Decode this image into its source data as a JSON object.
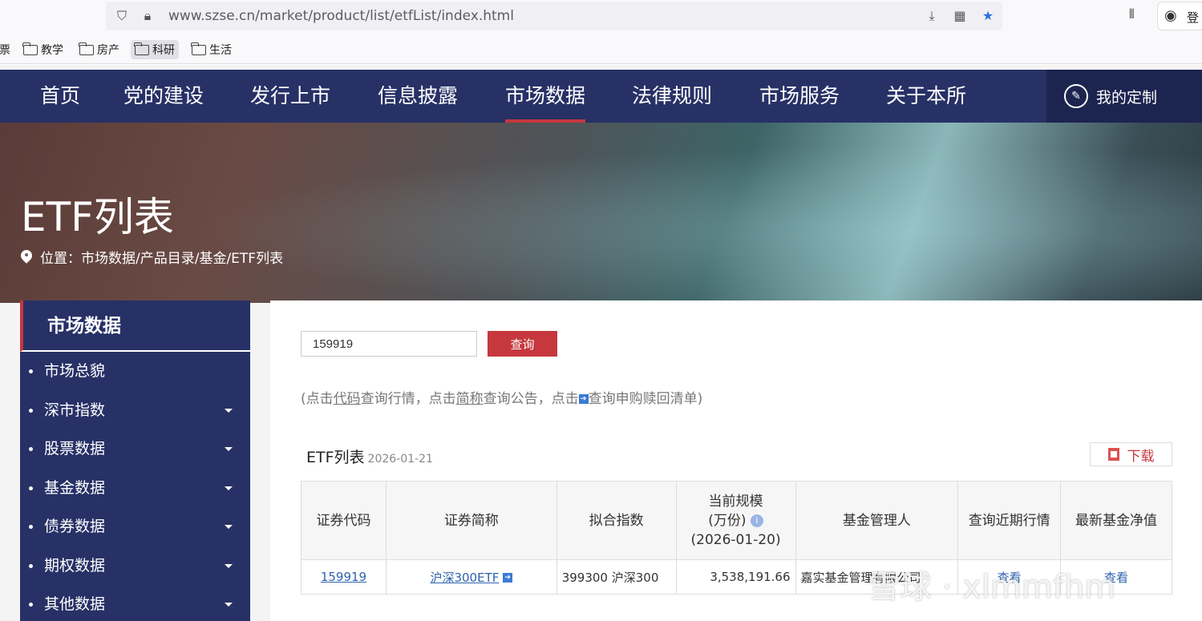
{
  "browser": {
    "url": "www.szse.cn/market/product/list/etfList/index.html",
    "profile_label": "登",
    "bookmarks": [
      "票",
      "教学",
      "房产",
      "科研",
      "生活"
    ]
  },
  "nav": {
    "items": [
      "首页",
      "党的建设",
      "发行上市",
      "信息披露",
      "市场数据",
      "法律规则",
      "市场服务",
      "关于本所"
    ],
    "active": "市场数据",
    "custom_label": "我的定制"
  },
  "banner": {
    "title": "ETF列表",
    "breadcrumb": "位置：市场数据/产品目录/基金/ETF列表"
  },
  "sidebar": {
    "title": "市场数据",
    "items": [
      {
        "label": "市场总貌",
        "expandable": false
      },
      {
        "label": "深市指数",
        "expandable": true
      },
      {
        "label": "股票数据",
        "expandable": true
      },
      {
        "label": "基金数据",
        "expandable": true
      },
      {
        "label": "债券数据",
        "expandable": true
      },
      {
        "label": "期权数据",
        "expandable": true
      },
      {
        "label": "其他数据",
        "expandable": true
      }
    ]
  },
  "search": {
    "value": "159919",
    "button_label": "查询"
  },
  "hint": {
    "part1": "(点击",
    "code": "代码",
    "part2": "查询行情，点击",
    "name": "简称",
    "part3": "查询公告，点击",
    "part4": "查询申购赎回清单)"
  },
  "list": {
    "title": "ETF列表",
    "date": "2026-01-21",
    "download_label": "下载",
    "columns": [
      "证券代码",
      "证券简称",
      "拟合指数",
      "当前规模",
      "(万份)",
      "(2026-01-20)",
      "基金管理人",
      "查询近期行情",
      "最新基金净值"
    ],
    "rows": [
      {
        "code": "159919",
        "name": "沪深300ETF",
        "index": "399300 沪深300",
        "scale": "3,538,191.66",
        "manager": "嘉实基金管理有限公司",
        "quote": "查看",
        "nav": "查看"
      }
    ]
  },
  "watermark": "雪球 · xlmmfhm",
  "colors": {
    "nav_bg": "#273166",
    "accent_red": "#c6373e",
    "link_blue": "#2f63ad"
  }
}
